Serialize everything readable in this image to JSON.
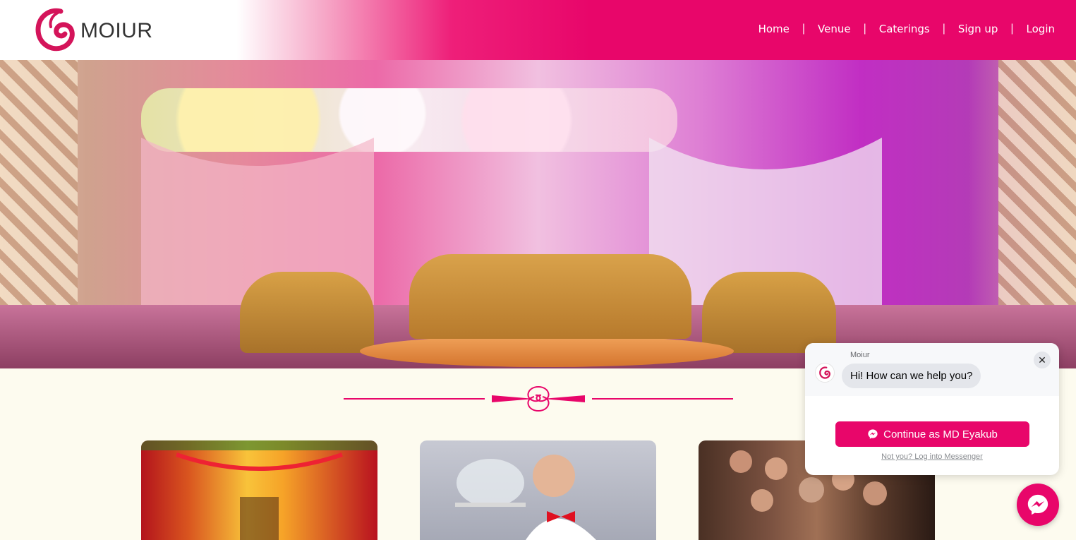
{
  "brand": {
    "name": "MOIUR",
    "accent_color": "#e8066a"
  },
  "nav": {
    "items": [
      {
        "label": "Home"
      },
      {
        "label": "Venue"
      },
      {
        "label": "Caterings"
      },
      {
        "label": "Sign up"
      },
      {
        "label": "Login"
      }
    ],
    "separator": "|"
  },
  "hero": {
    "slides_total": 2,
    "active_slide": 2,
    "image": "wedding-stage-decor"
  },
  "cards": [
    {
      "image": "wedding-venue-decor"
    },
    {
      "image": "catering-waiter"
    },
    {
      "image": "friends-party"
    }
  ],
  "chat": {
    "page_name": "Moiur",
    "greeting": "Hi! How can we help you?",
    "continue_button": "Continue as MD Eyakub",
    "alt_login_link": "Not you? Log into Messenger",
    "close_icon": "close-icon"
  },
  "messenger_fab": {
    "icon": "messenger-icon"
  }
}
